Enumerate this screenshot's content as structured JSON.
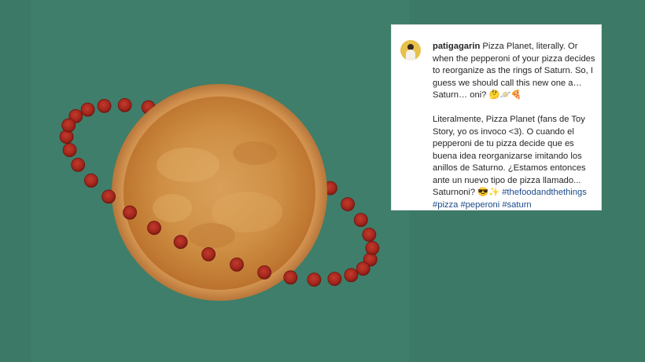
{
  "post": {
    "username": "patigagarin",
    "caption_en": "Pizza Planet, literally. Or when the pepperoni of your pizza decides to reorganize as the rings of Saturn. So, I guess we should call this new one a… Saturn… oni? 🤔🪐🍕",
    "caption_es": "Literalmente, Pizza Planet (fans de Toy Story, yo os invoco <3). O cuando el pepperoni de tu pizza decide que es buena idea reorganizarse imitando los anillos de Saturno. ¿Estamos entonces ante un nuevo tipo de pizza llamado... Saturnoni? 😎✨",
    "hashtags": {
      "tag1": "#thefoodandthethings",
      "tag2": "#pizza",
      "tag3": "#peperoni",
      "tag4": "#saturn"
    }
  },
  "colors": {
    "background": "#3c7a67",
    "hashtag": "#1a4a8a",
    "pizza_crust": "#c98a45",
    "pepperoni": "#a8261e"
  },
  "photo": {
    "subject": "cheese pizza with a ring of pepperoni slices arranged like Saturn's rings"
  }
}
